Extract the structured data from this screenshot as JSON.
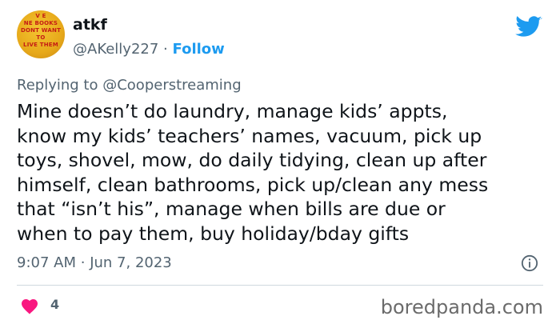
{
  "author": {
    "avatar_text": [
      "V E",
      "NE BOOKS",
      "DONT WANT",
      "TO",
      "LIVE THEM"
    ],
    "display_name": "atkf",
    "handle": "@AKelly227",
    "separator": "·",
    "follow_label": "Follow"
  },
  "reply": {
    "prefix": "Replying to",
    "mention": "@Cooperstreaming"
  },
  "tweet": {
    "lines": [
      "Mine doesn’t do laundry, manage kids’ appts,",
      "know my kids’ teachers’ names, vacuum, pick up",
      "toys, shovel, mow, do daily tidying, clean up after",
      "himself, clean bathrooms, pick up/clean any mess",
      "that “isn’t his”, manage when bills are due or",
      "when to pay them, buy holiday/bday gifts"
    ]
  },
  "meta": {
    "time": "9:07 AM",
    "separator": "·",
    "date": "Jun 7, 2023"
  },
  "engagement": {
    "likes": "4"
  },
  "watermark": "boredpanda.com",
  "colors": {
    "twitter_blue": "#1d9bf0",
    "heart_red": "#f91880",
    "text_primary": "#0f1419",
    "text_secondary": "#536471"
  },
  "icons": {
    "brand": "twitter-bird-icon",
    "info": "info-icon",
    "like": "heart-icon"
  }
}
